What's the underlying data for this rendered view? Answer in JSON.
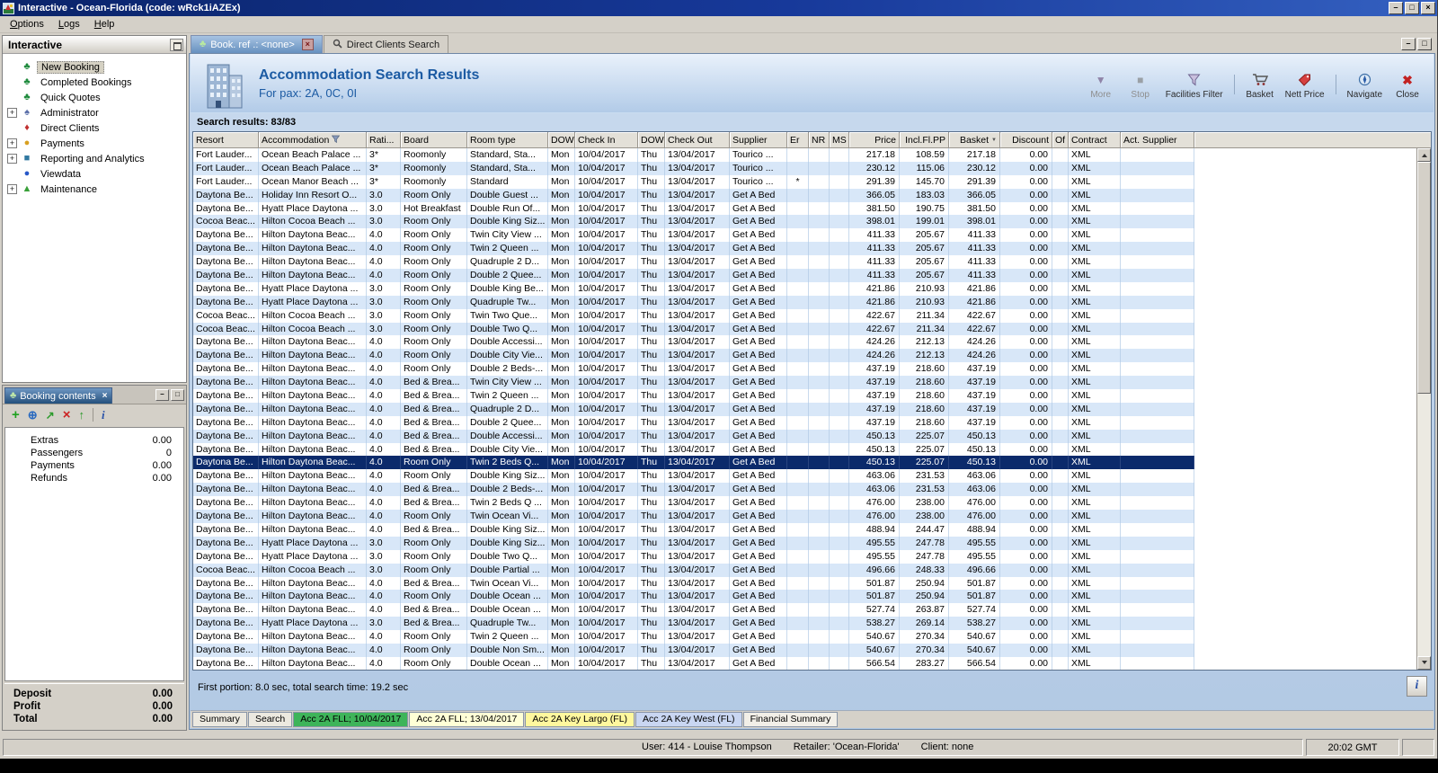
{
  "window": {
    "title": "Interactive - Ocean-Florida (code: wRck1iAZEx)",
    "buttons": [
      "minimize",
      "maximize",
      "close"
    ]
  },
  "menu": {
    "items": [
      "Options",
      "Logs",
      "Help"
    ]
  },
  "sidebar": {
    "title": "Interactive",
    "items": [
      {
        "label": "New Booking",
        "icon": "palm",
        "selected": true
      },
      {
        "label": "Completed Bookings",
        "icon": "palm"
      },
      {
        "label": "Quick Quotes",
        "icon": "palm"
      },
      {
        "label": "Administrator",
        "icon": "admin",
        "expandable": true
      },
      {
        "label": "Direct Clients",
        "icon": "clients"
      },
      {
        "label": "Payments",
        "icon": "payments",
        "expandable": true
      },
      {
        "label": "Reporting and Analytics",
        "icon": "reporting",
        "expandable": true
      },
      {
        "label": "Viewdata",
        "icon": "viewdata"
      },
      {
        "label": "Maintenance",
        "icon": "maintenance",
        "expandable": true
      }
    ]
  },
  "booking_contents": {
    "title": "Booking contents",
    "toolbar_icons": [
      "add",
      "globe",
      "transfer",
      "delete",
      "move-up",
      "info"
    ],
    "rows": [
      {
        "label": "Extras",
        "value": "0.00"
      },
      {
        "label": "Passengers",
        "value": "0"
      },
      {
        "label": "Payments",
        "value": "0.00"
      },
      {
        "label": "Refunds",
        "value": "0.00"
      }
    ],
    "summary": [
      {
        "label": "Deposit",
        "value": "0.00"
      },
      {
        "label": "Profit",
        "value": "0.00"
      },
      {
        "label": "Total",
        "value": "0.00"
      }
    ]
  },
  "doc_tabs": [
    {
      "label": "Book. ref .: <none>",
      "active": true,
      "closable": true
    },
    {
      "label": "Direct Clients Search",
      "active": false,
      "closable": false
    }
  ],
  "header": {
    "title": "Accommodation Search Results",
    "subtitle": "For pax: 2A, 0C, 0I",
    "buttons": [
      {
        "label": "More",
        "icon": "more",
        "disabled": true
      },
      {
        "label": "Stop",
        "icon": "stop",
        "disabled": true
      },
      {
        "label": "Facilities Filter",
        "icon": "filter",
        "disabled": false
      },
      {
        "label": "Basket",
        "icon": "basket",
        "disabled": false,
        "sep_before": true
      },
      {
        "label": "Nett Price",
        "icon": "nett-price",
        "disabled": false
      },
      {
        "label": "Navigate",
        "icon": "navigate",
        "disabled": false,
        "sep_before": true
      },
      {
        "label": "Close",
        "icon": "close",
        "disabled": false
      }
    ]
  },
  "results": {
    "label": "Search results: 83/83",
    "columns": [
      "Resort",
      "Accommodation",
      "Rati...",
      "Board",
      "Room type",
      "DOW",
      "Check In",
      "DOW",
      "Check Out",
      "Supplier",
      "Er",
      "NR",
      "MS",
      "Price",
      "Incl.Fl.PP",
      "Basket",
      "Discount",
      "Of",
      "Contract",
      "Act. Supplier"
    ],
    "defaults": {
      "dow_in": "Mon",
      "check_in": "10/04/2017",
      "dow_out": "Thu",
      "check_out": "13/04/2017",
      "discount": "0.00",
      "contract": "XML"
    },
    "selected_index": 23,
    "rows": [
      [
        "Fort Lauder...",
        "Ocean Beach Palace ...",
        "3*",
        "Roomonly",
        "Standard, Sta...",
        "Tourico ...",
        "",
        "217.18",
        "108.59",
        "217.18"
      ],
      [
        "Fort Lauder...",
        "Ocean Beach Palace ...",
        "3*",
        "Roomonly",
        "Standard, Sta...",
        "Tourico ...",
        "",
        "230.12",
        "115.06",
        "230.12"
      ],
      [
        "Fort Lauder...",
        "Ocean Manor Beach ...",
        "3*",
        "Roomonly",
        "Standard",
        "Tourico ...",
        "*",
        "291.39",
        "145.70",
        "291.39"
      ],
      [
        "Daytona Be...",
        "Holiday Inn Resort O...",
        "3.0",
        "Room Only",
        "Double Guest ...",
        "Get A Bed",
        "",
        "366.05",
        "183.03",
        "366.05"
      ],
      [
        "Daytona Be...",
        "Hyatt Place Daytona ...",
        "3.0",
        "Hot Breakfast",
        "Double Run Of...",
        "Get A Bed",
        "",
        "381.50",
        "190.75",
        "381.50"
      ],
      [
        "Cocoa Beac...",
        "Hilton Cocoa Beach ...",
        "3.0",
        "Room Only",
        "Double King Siz...",
        "Get A Bed",
        "",
        "398.01",
        "199.01",
        "398.01"
      ],
      [
        "Daytona Be...",
        "Hilton Daytona Beac...",
        "4.0",
        "Room Only",
        "Twin City View ...",
        "Get A Bed",
        "",
        "411.33",
        "205.67",
        "411.33"
      ],
      [
        "Daytona Be...",
        "Hilton Daytona Beac...",
        "4.0",
        "Room Only",
        "Twin 2 Queen ...",
        "Get A Bed",
        "",
        "411.33",
        "205.67",
        "411.33"
      ],
      [
        "Daytona Be...",
        "Hilton Daytona Beac...",
        "4.0",
        "Room Only",
        "Quadruple 2 D...",
        "Get A Bed",
        "",
        "411.33",
        "205.67",
        "411.33"
      ],
      [
        "Daytona Be...",
        "Hilton Daytona Beac...",
        "4.0",
        "Room Only",
        "Double 2 Quee...",
        "Get A Bed",
        "",
        "411.33",
        "205.67",
        "411.33"
      ],
      [
        "Daytona Be...",
        "Hyatt Place Daytona ...",
        "3.0",
        "Room Only",
        "Double King Be...",
        "Get A Bed",
        "",
        "421.86",
        "210.93",
        "421.86"
      ],
      [
        "Daytona Be...",
        "Hyatt Place Daytona ...",
        "3.0",
        "Room Only",
        "Quadruple Tw...",
        "Get A Bed",
        "",
        "421.86",
        "210.93",
        "421.86"
      ],
      [
        "Cocoa Beac...",
        "Hilton Cocoa Beach ...",
        "3.0",
        "Room Only",
        "Twin Two Que...",
        "Get A Bed",
        "",
        "422.67",
        "211.34",
        "422.67"
      ],
      [
        "Cocoa Beac...",
        "Hilton Cocoa Beach ...",
        "3.0",
        "Room Only",
        "Double Two Q...",
        "Get A Bed",
        "",
        "422.67",
        "211.34",
        "422.67"
      ],
      [
        "Daytona Be...",
        "Hilton Daytona Beac...",
        "4.0",
        "Room Only",
        "Double Accessi...",
        "Get A Bed",
        "",
        "424.26",
        "212.13",
        "424.26"
      ],
      [
        "Daytona Be...",
        "Hilton Daytona Beac...",
        "4.0",
        "Room Only",
        "Double City Vie...",
        "Get A Bed",
        "",
        "424.26",
        "212.13",
        "424.26"
      ],
      [
        "Daytona Be...",
        "Hilton Daytona Beac...",
        "4.0",
        "Room Only",
        "Double 2 Beds-...",
        "Get A Bed",
        "",
        "437.19",
        "218.60",
        "437.19"
      ],
      [
        "Daytona Be...",
        "Hilton Daytona Beac...",
        "4.0",
        "Bed & Brea...",
        "Twin City View ...",
        "Get A Bed",
        "",
        "437.19",
        "218.60",
        "437.19"
      ],
      [
        "Daytona Be...",
        "Hilton Daytona Beac...",
        "4.0",
        "Bed & Brea...",
        "Twin 2 Queen ...",
        "Get A Bed",
        "",
        "437.19",
        "218.60",
        "437.19"
      ],
      [
        "Daytona Be...",
        "Hilton Daytona Beac...",
        "4.0",
        "Bed & Brea...",
        "Quadruple 2 D...",
        "Get A Bed",
        "",
        "437.19",
        "218.60",
        "437.19"
      ],
      [
        "Daytona Be...",
        "Hilton Daytona Beac...",
        "4.0",
        "Bed & Brea...",
        "Double 2 Quee...",
        "Get A Bed",
        "",
        "437.19",
        "218.60",
        "437.19"
      ],
      [
        "Daytona Be...",
        "Hilton Daytona Beac...",
        "4.0",
        "Bed & Brea...",
        "Double Accessi...",
        "Get A Bed",
        "",
        "450.13",
        "225.07",
        "450.13"
      ],
      [
        "Daytona Be...",
        "Hilton Daytona Beac...",
        "4.0",
        "Bed & Brea...",
        "Double City Vie...",
        "Get A Bed",
        "",
        "450.13",
        "225.07",
        "450.13"
      ],
      [
        "Daytona Be...",
        "Hilton Daytona Beac...",
        "4.0",
        "Room Only",
        "Twin 2 Beds Q...",
        "Get A Bed",
        "",
        "450.13",
        "225.07",
        "450.13"
      ],
      [
        "Daytona Be...",
        "Hilton Daytona Beac...",
        "4.0",
        "Room Only",
        "Double King Siz...",
        "Get A Bed",
        "",
        "463.06",
        "231.53",
        "463.06"
      ],
      [
        "Daytona Be...",
        "Hilton Daytona Beac...",
        "4.0",
        "Bed & Brea...",
        "Double 2 Beds-...",
        "Get A Bed",
        "",
        "463.06",
        "231.53",
        "463.06"
      ],
      [
        "Daytona Be...",
        "Hilton Daytona Beac...",
        "4.0",
        "Bed & Brea...",
        "Twin 2 Beds Q ...",
        "Get A Bed",
        "",
        "476.00",
        "238.00",
        "476.00"
      ],
      [
        "Daytona Be...",
        "Hilton Daytona Beac...",
        "4.0",
        "Room Only",
        "Twin Ocean Vi...",
        "Get A Bed",
        "",
        "476.00",
        "238.00",
        "476.00"
      ],
      [
        "Daytona Be...",
        "Hilton Daytona Beac...",
        "4.0",
        "Bed & Brea...",
        "Double King Siz...",
        "Get A Bed",
        "",
        "488.94",
        "244.47",
        "488.94"
      ],
      [
        "Daytona Be...",
        "Hyatt Place Daytona ...",
        "3.0",
        "Room Only",
        "Double King Siz...",
        "Get A Bed",
        "",
        "495.55",
        "247.78",
        "495.55"
      ],
      [
        "Daytona Be...",
        "Hyatt Place Daytona ...",
        "3.0",
        "Room Only",
        "Double Two Q...",
        "Get A Bed",
        "",
        "495.55",
        "247.78",
        "495.55"
      ],
      [
        "Cocoa Beac...",
        "Hilton Cocoa Beach ...",
        "3.0",
        "Room Only",
        "Double Partial ...",
        "Get A Bed",
        "",
        "496.66",
        "248.33",
        "496.66"
      ],
      [
        "Daytona Be...",
        "Hilton Daytona Beac...",
        "4.0",
        "Bed & Brea...",
        "Twin Ocean Vi...",
        "Get A Bed",
        "",
        "501.87",
        "250.94",
        "501.87"
      ],
      [
        "Daytona Be...",
        "Hilton Daytona Beac...",
        "4.0",
        "Room Only",
        "Double Ocean ...",
        "Get A Bed",
        "",
        "501.87",
        "250.94",
        "501.87"
      ],
      [
        "Daytona Be...",
        "Hilton Daytona Beac...",
        "4.0",
        "Bed & Brea...",
        "Double Ocean ...",
        "Get A Bed",
        "",
        "527.74",
        "263.87",
        "527.74"
      ],
      [
        "Daytona Be...",
        "Hyatt Place Daytona ...",
        "3.0",
        "Bed & Brea...",
        "Quadruple Tw...",
        "Get A Bed",
        "",
        "538.27",
        "269.14",
        "538.27"
      ],
      [
        "Daytona Be...",
        "Hilton Daytona Beac...",
        "4.0",
        "Room Only",
        "Twin 2 Queen ...",
        "Get A Bed",
        "",
        "540.67",
        "270.34",
        "540.67"
      ],
      [
        "Daytona Be...",
        "Hilton Daytona Beac...",
        "4.0",
        "Room Only",
        "Double Non Sm...",
        "Get A Bed",
        "",
        "540.67",
        "270.34",
        "540.67"
      ],
      [
        "Daytona Be...",
        "Hilton Daytona Beac...",
        "4.0",
        "Room Only",
        "Double Ocean ...",
        "Get A Bed",
        "",
        "566.54",
        "283.27",
        "566.54"
      ]
    ],
    "footer": "First portion: 8.0 sec, total search time: 19.2 sec"
  },
  "bottom_tabs": [
    {
      "label": "Summary",
      "color": "#ece9e0"
    },
    {
      "label": "Search",
      "color": "#ece9e0"
    },
    {
      "label": "Acc 2A FLL; 10/04/2017",
      "color": "#3eb45a"
    },
    {
      "label": "Acc 2A FLL; 13/04/2017",
      "color": "#ffffd6"
    },
    {
      "label": "Acc 2A Key Largo (FL)",
      "color": "#fff79e"
    },
    {
      "label": "Acc 2A Key West (FL)",
      "color": "#c9d6f2"
    },
    {
      "label": "Financial Summary",
      "color": "#f2efe8"
    }
  ],
  "statusbar": {
    "user": "User: 414 - Louise Thompson",
    "retailer": "Retailer: 'Ocean-Florida'",
    "client": "Client: none",
    "time": "20:02 GMT"
  },
  "colors": {
    "selection": "#0b2a6b",
    "row_alt": "#d8e7f8",
    "titlebar": "#0a246a",
    "tab_active_green": "#3eb45a"
  }
}
